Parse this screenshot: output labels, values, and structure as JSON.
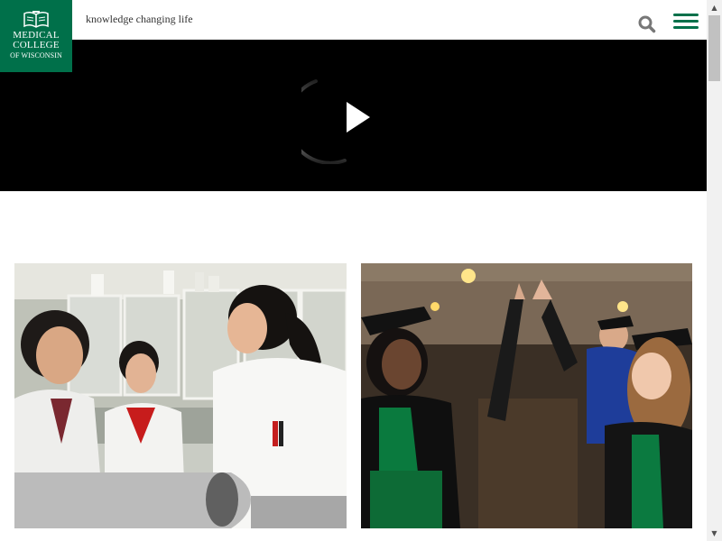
{
  "header": {
    "logo": {
      "line1": "MEDICAL",
      "line2": "COLLEGE",
      "line3": "OF WISCONSIN",
      "brand_color": "#00704a"
    },
    "tagline": "knowledge changing life",
    "search_icon": "search-icon",
    "menu_icon": "hamburger-menu-icon",
    "accent_color": "#00704a"
  },
  "video": {
    "play_icon": "play-icon",
    "background": "#000000"
  },
  "cards": [
    {
      "image": "researchers-in-laboratory-photo"
    },
    {
      "image": "graduates-high-five-photo"
    }
  ],
  "scrollbar": {
    "up_arrow": "▲",
    "down_arrow": "▼"
  }
}
